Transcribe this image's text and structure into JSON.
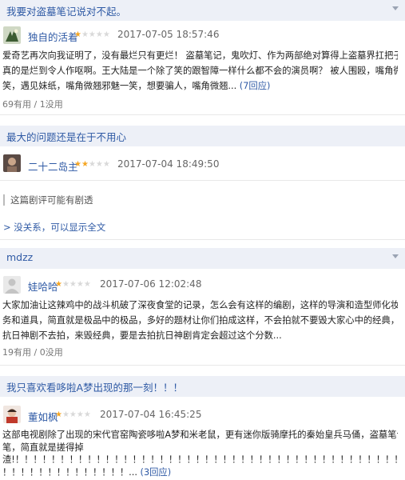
{
  "reviews": [
    {
      "title": "我要对盗墓笔记说对不起。",
      "user": "独自的活着",
      "rating": 1,
      "time": "2017-07-05 18:57:46",
      "lines": [
        "爱奇艺再次向我证明了，没有最烂只有更烂！ 盗墓笔记，鬼吹灯、作为两部绝对算得上盗墓界扛把子的作品,",
        "真的是烂到令人作呕啊。王大陆是一个除了笑的跟智障一样什么都不会的演员啊？ 被人围殴，嘴角微翘邪魅一",
        "笑，遇见妹纸，嘴角微翘邪魅一笑，想要骗人，嘴角微翘..."
      ],
      "more": "(7回应)",
      "votes": "69有用 / 1没用"
    },
    {
      "title": "最大的问题还是在于不用心",
      "user": "二十二岛主",
      "rating": 2,
      "time": "2017-07-04 18:49:50",
      "spoiler": "这篇剧评可能有剧透",
      "show_all": "> 没关系，可以显示全文"
    },
    {
      "title": "mdzz",
      "user": "娃哈哈",
      "rating": 1,
      "time": "2017-07-06 12:02:48",
      "lines": [
        "大家加油让这辣鸡中的战斗机破了深夜食堂的记录，怎么会有这样的编剧，这样的导演和造型师化妆师，场务剧",
        "务和道具，简直就是极品中的极品，多好的题材让你们拍成这样，不会拍就不要毁大家心中的经典，放着好好的",
        "抗日神剧不去拍，来毁经典，要是去拍抗日神剧肯定会超过这个分数..."
      ],
      "votes": "19有用 / 0没用"
    },
    {
      "title": "我只喜欢看哆啦A梦出现的那一刻！！！",
      "user": "董如枫",
      "rating": 1,
      "time": "2017-07-04 16:45:25",
      "lines": [
        "这部电视剧除了出现的宋代官窑陶瓷哆啦A梦和米老鼠，更有迷你版骑摩托的秦始皇兵马俑，盗墓笔记跟他一",
        "笔，简直就是搓得掉",
        "渣!！！！！！！！！！！！！！！！！！！！！！！！！！！！！！！！！！！！！！！！！！！！！",
        "！！！！！！！！！！！！！！..."
      ],
      "more": "(3回应)"
    }
  ],
  "colors": {
    "link": "#2f5aa5",
    "star_on": "#f5a623",
    "star_off": "#d9d9d9",
    "title_bg": "#edf0f7"
  }
}
